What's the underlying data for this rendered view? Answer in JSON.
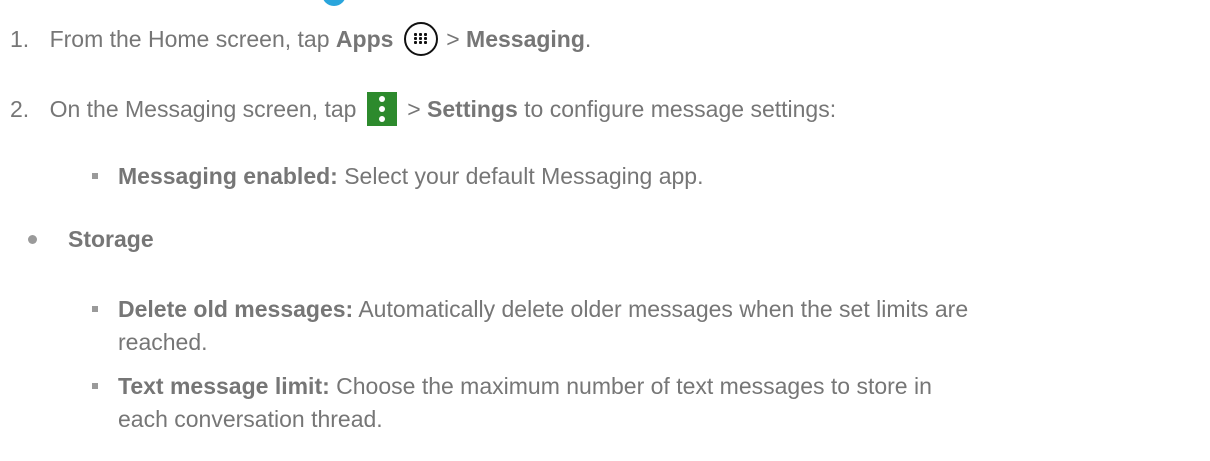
{
  "steps": [
    {
      "number": "1.",
      "text_before": "From the Home screen, tap ",
      "bold1": "Apps",
      "sep": " > ",
      "bold2": "Messaging",
      "end": "."
    },
    {
      "number": "2.",
      "text_before": "On the Messaging screen, tap ",
      "sep": " > ",
      "bold": "Settings",
      "text_after": " to configure message settings:"
    }
  ],
  "messaging_enabled": {
    "label": "Messaging enabled:",
    "desc": " Select your default Messaging app."
  },
  "storage_heading": "Storage",
  "delete_old": {
    "label": "Delete old messages:",
    "desc": " Automatically delete older messages when the set limits are",
    "desc2": "reached."
  },
  "text_limit": {
    "label": "Text message limit:",
    "desc": " Choose the maximum number of text messages to store in",
    "desc2": "each conversation thread."
  },
  "icons": {
    "apps": "apps-grid-icon",
    "menu": "more-options-icon"
  },
  "colors": {
    "text": "#767676",
    "menu_icon_bg": "#2d8a2d",
    "accent": "#2aa5dc"
  }
}
